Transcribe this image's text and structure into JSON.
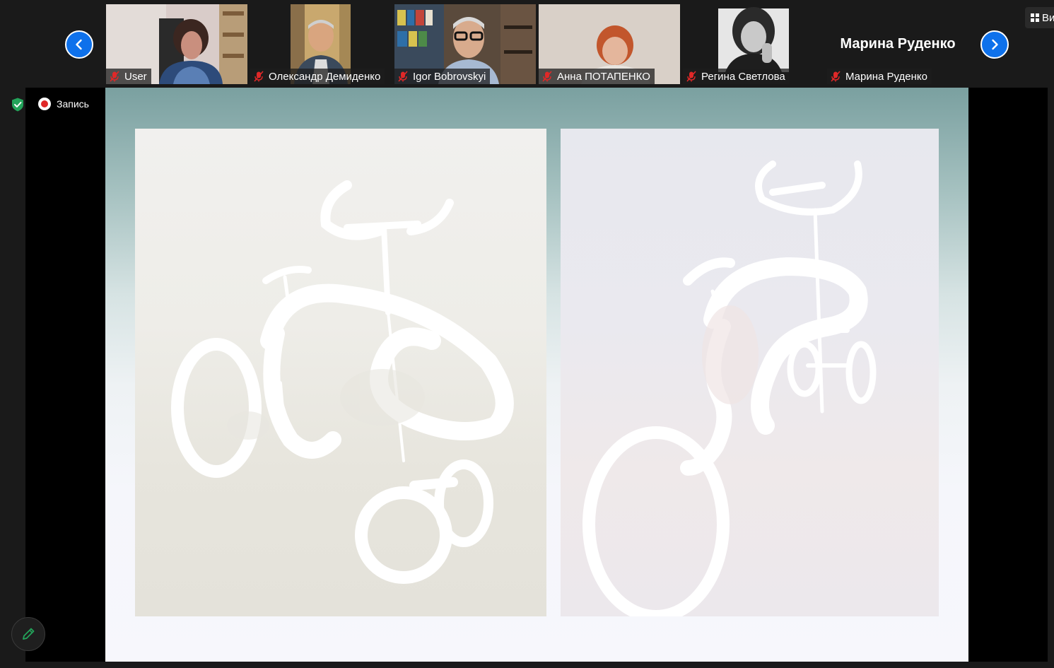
{
  "gallery": {
    "participants": [
      {
        "name": "User",
        "muted": true
      },
      {
        "name": "Олександр Демиденко",
        "muted": true
      },
      {
        "name": "Igor Bobrovskyi",
        "muted": true
      },
      {
        "name": "Анна ПОТАПЕНКО",
        "muted": true
      },
      {
        "name": "Регина Светлова",
        "muted": true
      },
      {
        "name": "Марина Руденко",
        "muted": true,
        "video_off": true,
        "big_label": "Марина Руденко"
      }
    ],
    "view_label": "Ви"
  },
  "recording": {
    "label": "Запись"
  },
  "icons": {
    "prev": "chevron-left-icon",
    "next": "chevron-right-icon",
    "mic": "mic-off-icon",
    "shield": "shield-check-icon",
    "pen": "pencil-icon",
    "view": "grid-icon"
  },
  "colors": {
    "nav_button": "#0e71eb",
    "mic_off": "#e02828",
    "shield": "#23a35a",
    "pen": "#23a35a"
  }
}
